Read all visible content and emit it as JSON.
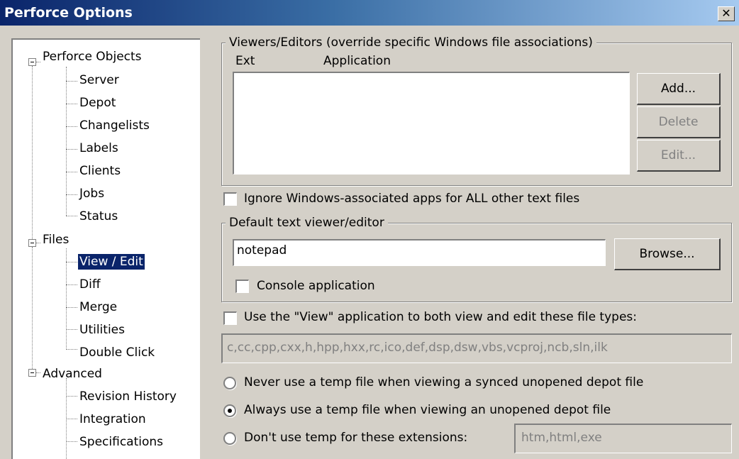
{
  "window": {
    "title": "Perforce Options",
    "close_glyph": "✕"
  },
  "tree": {
    "groups": [
      {
        "label": "Perforce Objects",
        "children": [
          "Server",
          "Depot",
          "Changelists",
          "Labels",
          "Clients",
          "Jobs",
          "Status"
        ]
      },
      {
        "label": "Files",
        "children": [
          "View / Edit",
          "Diff",
          "Merge",
          "Utilities",
          "Double Click"
        ]
      },
      {
        "label": "Advanced",
        "children": [
          "Revision History",
          "Integration",
          "Specifications"
        ]
      }
    ],
    "selected": "View / Edit"
  },
  "viewers": {
    "group_title": "Viewers/Editors (override specific Windows file associations)",
    "col_ext": "Ext",
    "col_app": "Application",
    "add_label": "Add...",
    "delete_label": "Delete",
    "edit_label": "Edit..."
  },
  "ignore_checkbox_label": "Ignore Windows-associated apps for ALL other text files",
  "default_editor": {
    "group_title": "Default text viewer/editor",
    "value": "notepad",
    "browse_label": "Browse...",
    "console_label": "Console application"
  },
  "use_view": {
    "label": "Use the \"View\" application to both view and edit these file types:",
    "extensions": "c,cc,cpp,cxx,h,hpp,hxx,rc,ico,def,dsp,dsw,vbs,vcproj,ncb,sln,ilk"
  },
  "temp_options": {
    "never": "Never use a temp file when viewing a synced unopened depot file",
    "always": "Always use a temp file when viewing an unopened depot file",
    "dont": "Don't use temp for these extensions:",
    "dont_extensions": "htm,html,exe",
    "selected": "always"
  }
}
